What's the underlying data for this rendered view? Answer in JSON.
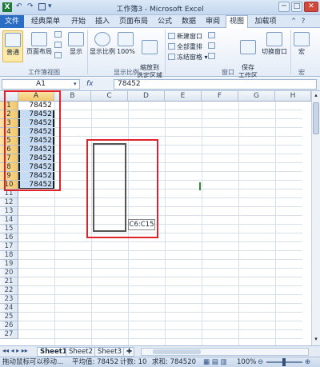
{
  "window": {
    "title": "工作簿3 - Microsoft Excel",
    "quick_access": [
      "↶",
      "↷",
      "▾"
    ],
    "controls": [
      "─",
      "□",
      "✕"
    ]
  },
  "tabs": [
    "文件",
    "经典菜单",
    "开始",
    "插入",
    "页面布局",
    "公式",
    "数据",
    "审阅",
    "视图",
    "加载项"
  ],
  "ribbon": {
    "normal": "普通",
    "page_layout": "页面布局",
    "show": "显示",
    "zoom": "显示比例",
    "zoom100": "100%",
    "zoom_selection": "缩放到\n选定区域",
    "new_window": "新建窗口",
    "arrange_all": "全部重排",
    "freeze_panes": "冻结窗格",
    "save_workspace": "保存\n工作区",
    "switch_windows": "切换窗口",
    "macros": "宏",
    "group_workbook_views": "工作簿视图",
    "group_zoom": "显示比例",
    "group_window": "窗口",
    "group_macros": "宏"
  },
  "formula_bar": {
    "name_box": "A1",
    "fx": "fx",
    "content": "78452"
  },
  "grid": {
    "columns": [
      "A",
      "B",
      "C",
      "D",
      "E",
      "F",
      "G",
      "H"
    ],
    "rows": [
      "1",
      "2",
      "3",
      "4",
      "5",
      "6",
      "7",
      "8",
      "9",
      "10",
      "11",
      "12",
      "13",
      "14",
      "15",
      "16",
      "17",
      "18",
      "19",
      "20",
      "21",
      "22",
      "23",
      "24",
      "25",
      "26",
      "27"
    ],
    "a_values": [
      "78452",
      "78452",
      "78452",
      "78452",
      "78452",
      "78452",
      "78452",
      "78452",
      "78452",
      "78452"
    ],
    "drag_tooltip": "C6:C15"
  },
  "sheets": [
    "Sheet1",
    "Sheet2",
    "Sheet3"
  ],
  "status": {
    "message": "拖动鼠标可以移动...",
    "average": "平均值: 78452",
    "count": "计数: 10",
    "sum": "求和: 784520",
    "zoom": "100%"
  },
  "colors": {
    "highlight": "#e0232b",
    "selection": "#c6dcf5",
    "file_tab": "#2b6dc4"
  }
}
